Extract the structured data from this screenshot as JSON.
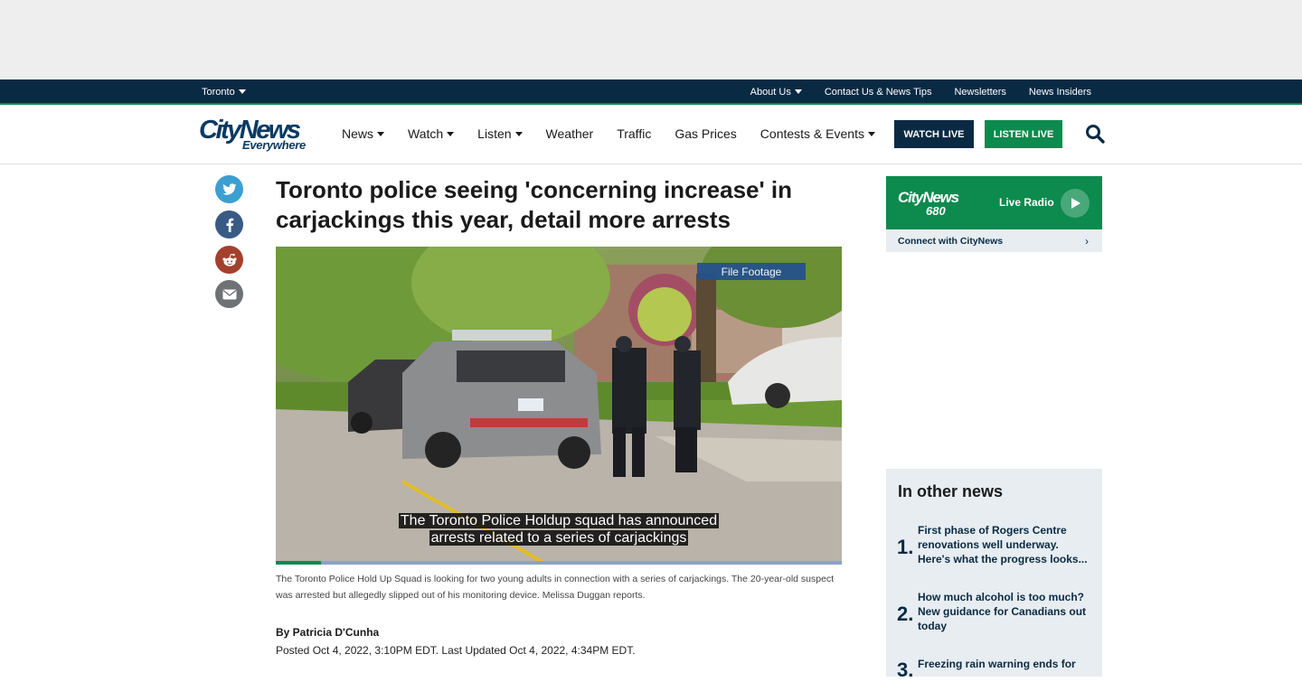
{
  "colors": {
    "navy": "#0a2a44",
    "green": "#0d8a4e",
    "panel": "#e7edf1"
  },
  "topbar": {
    "location": "Toronto",
    "links": [
      "About Us",
      "Contact Us & News Tips",
      "Newsletters",
      "News Insiders"
    ]
  },
  "logo": {
    "primary": "CityNews",
    "secondary": "Everywhere"
  },
  "nav": {
    "items": [
      {
        "label": "News",
        "dropdown": true
      },
      {
        "label": "Watch",
        "dropdown": true
      },
      {
        "label": "Listen",
        "dropdown": true
      },
      {
        "label": "Weather",
        "dropdown": false
      },
      {
        "label": "Traffic",
        "dropdown": false
      },
      {
        "label": "Gas Prices",
        "dropdown": false
      },
      {
        "label": "Contests & Events",
        "dropdown": true
      }
    ],
    "watch_live": "WATCH LIVE",
    "listen_live": "LISTEN LIVE"
  },
  "share": [
    "twitter-icon",
    "facebook-icon",
    "reddit-icon",
    "email-icon"
  ],
  "article": {
    "headline": "Toronto police seeing 'concerning increase' in carjackings this year, detail more arrests",
    "video": {
      "badge": "File Footage",
      "subtitle_line1": "The Toronto Police Holdup squad has announced",
      "subtitle_line2": "arrests related to a series of carjackings",
      "progress": 0.08
    },
    "caption": "The Toronto Police Hold Up Squad is looking for two young adults in connection with a series of carjackings. The 20-year-old suspect was arrested but allegedly slipped out of his monitoring device. Melissa Duggan reports.",
    "byline": "By Patricia D'Cunha",
    "posted": "Posted Oct 4, 2022, 3:10PM EDT. Last Updated Oct 4, 2022, 4:34PM EDT."
  },
  "radio": {
    "brand": "CityNews",
    "station": "680",
    "label": "Live Radio",
    "connect": "Connect with CityNews"
  },
  "other_news": {
    "title": "In other news",
    "items": [
      {
        "num": "1.",
        "text": "First phase of Rogers Centre renovations well underway. Here's what the progress looks..."
      },
      {
        "num": "2.",
        "text": "How much alcohol is too much? New guidance for Canadians out today"
      },
      {
        "num": "3.",
        "text": "Freezing rain warning ends for"
      }
    ]
  }
}
